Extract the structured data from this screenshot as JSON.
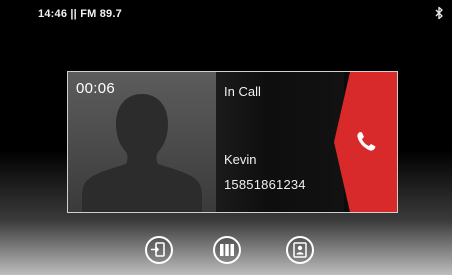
{
  "status_bar": {
    "text": "14:46 || FM 89.7",
    "bluetooth_icon": "bluetooth-icon"
  },
  "call": {
    "timer": "00:06",
    "state": "In Call",
    "caller_name": "Kevin",
    "caller_number": "15851861234",
    "avatar_icon": "person-silhouette-icon",
    "hangup_icon": "phone-handset-icon",
    "hangup_color": "#d82a2a"
  },
  "bottom_controls": [
    {
      "icon": "transfer-audio-icon"
    },
    {
      "icon": "keypad-icon"
    },
    {
      "icon": "contacts-icon"
    }
  ]
}
